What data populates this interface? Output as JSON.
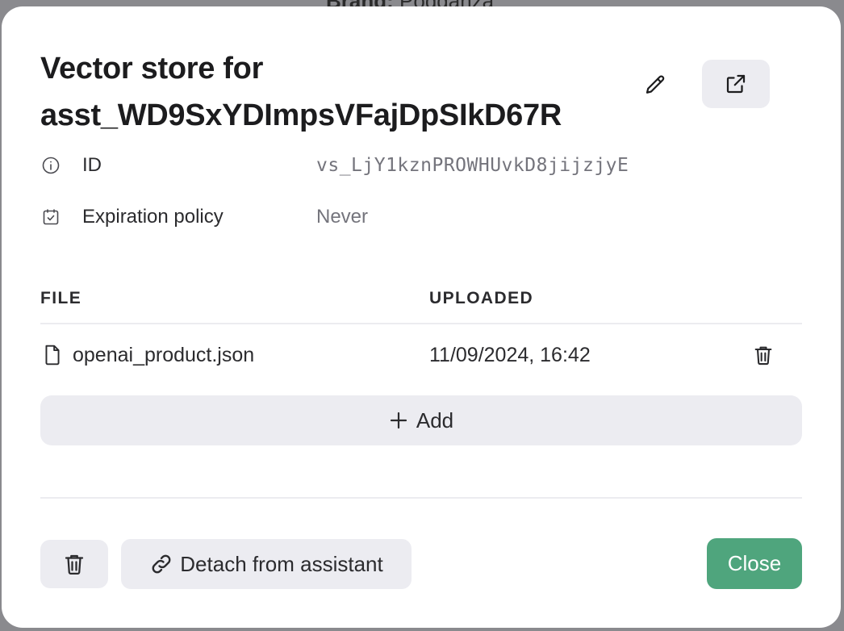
{
  "backdrop": {
    "label": "Brand:",
    "value": "Podganza"
  },
  "dialog": {
    "title": "Vector store for asst_WD9SxYDImpsVFajDpSIkD67R",
    "meta": {
      "id_label": "ID",
      "id_value": "vs_LjY1kznPROWHUvkD8jijzjyE",
      "expiration_label": "Expiration policy",
      "expiration_value": "Never"
    },
    "table": {
      "headers": [
        "FILE",
        "UPLOADED"
      ],
      "rows": [
        {
          "file": "openai_product.json",
          "uploaded": "11/09/2024, 16:42"
        }
      ]
    },
    "add_label": "Add",
    "detach_label": "Detach from assistant",
    "close_label": "Close"
  },
  "colors": {
    "accent": "#4fa57d",
    "button_bg": "#ececf1",
    "backdrop": "#8a8a8e"
  },
  "icons": {
    "edit": "pencil-icon",
    "open": "external-link-icon",
    "id": "info-icon",
    "expiration": "calendar-check-icon",
    "file": "file-icon",
    "delete": "trash-icon",
    "add": "plus-icon",
    "detach": "link-icon"
  }
}
